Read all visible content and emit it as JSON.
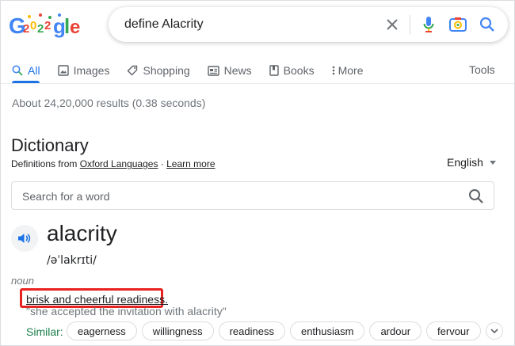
{
  "logo": {
    "text": "Google",
    "style": "doodle-2022"
  },
  "search": {
    "query": "define Alacrity"
  },
  "tabs": [
    {
      "label": "All",
      "icon": "search-icon",
      "active": true
    },
    {
      "label": "Images",
      "icon": "image-icon"
    },
    {
      "label": "Shopping",
      "icon": "tag-icon"
    },
    {
      "label": "News",
      "icon": "newspaper-icon"
    },
    {
      "label": "Books",
      "icon": "book-icon"
    },
    {
      "label": "More",
      "icon": "kebab-icon"
    }
  ],
  "tools_label": "Tools",
  "results_stats": "About 24,20,000 results (0.38 seconds)",
  "dictionary": {
    "title": "Dictionary",
    "source_prefix": "Definitions from ",
    "source_name": "Oxford Languages",
    "source_sep": " · ",
    "learn_more": "Learn more",
    "language": "English",
    "search_placeholder": "Search for a word",
    "word": "alacrity",
    "phonetic": "/əˈlakrɪti/",
    "part_of_speech": "noun",
    "definition": "brisk and cheerful readiness.",
    "example": "\"she accepted the invitation with alacrity\"",
    "similar_label": "Similar:",
    "similar": [
      "eagerness",
      "willingness",
      "readiness",
      "enthusiasm",
      "ardour",
      "fervour"
    ]
  },
  "colors": {
    "accent_blue": "#1a73e8",
    "highlight_red": "#e8221e",
    "similar_green": "#1a7f4b"
  }
}
